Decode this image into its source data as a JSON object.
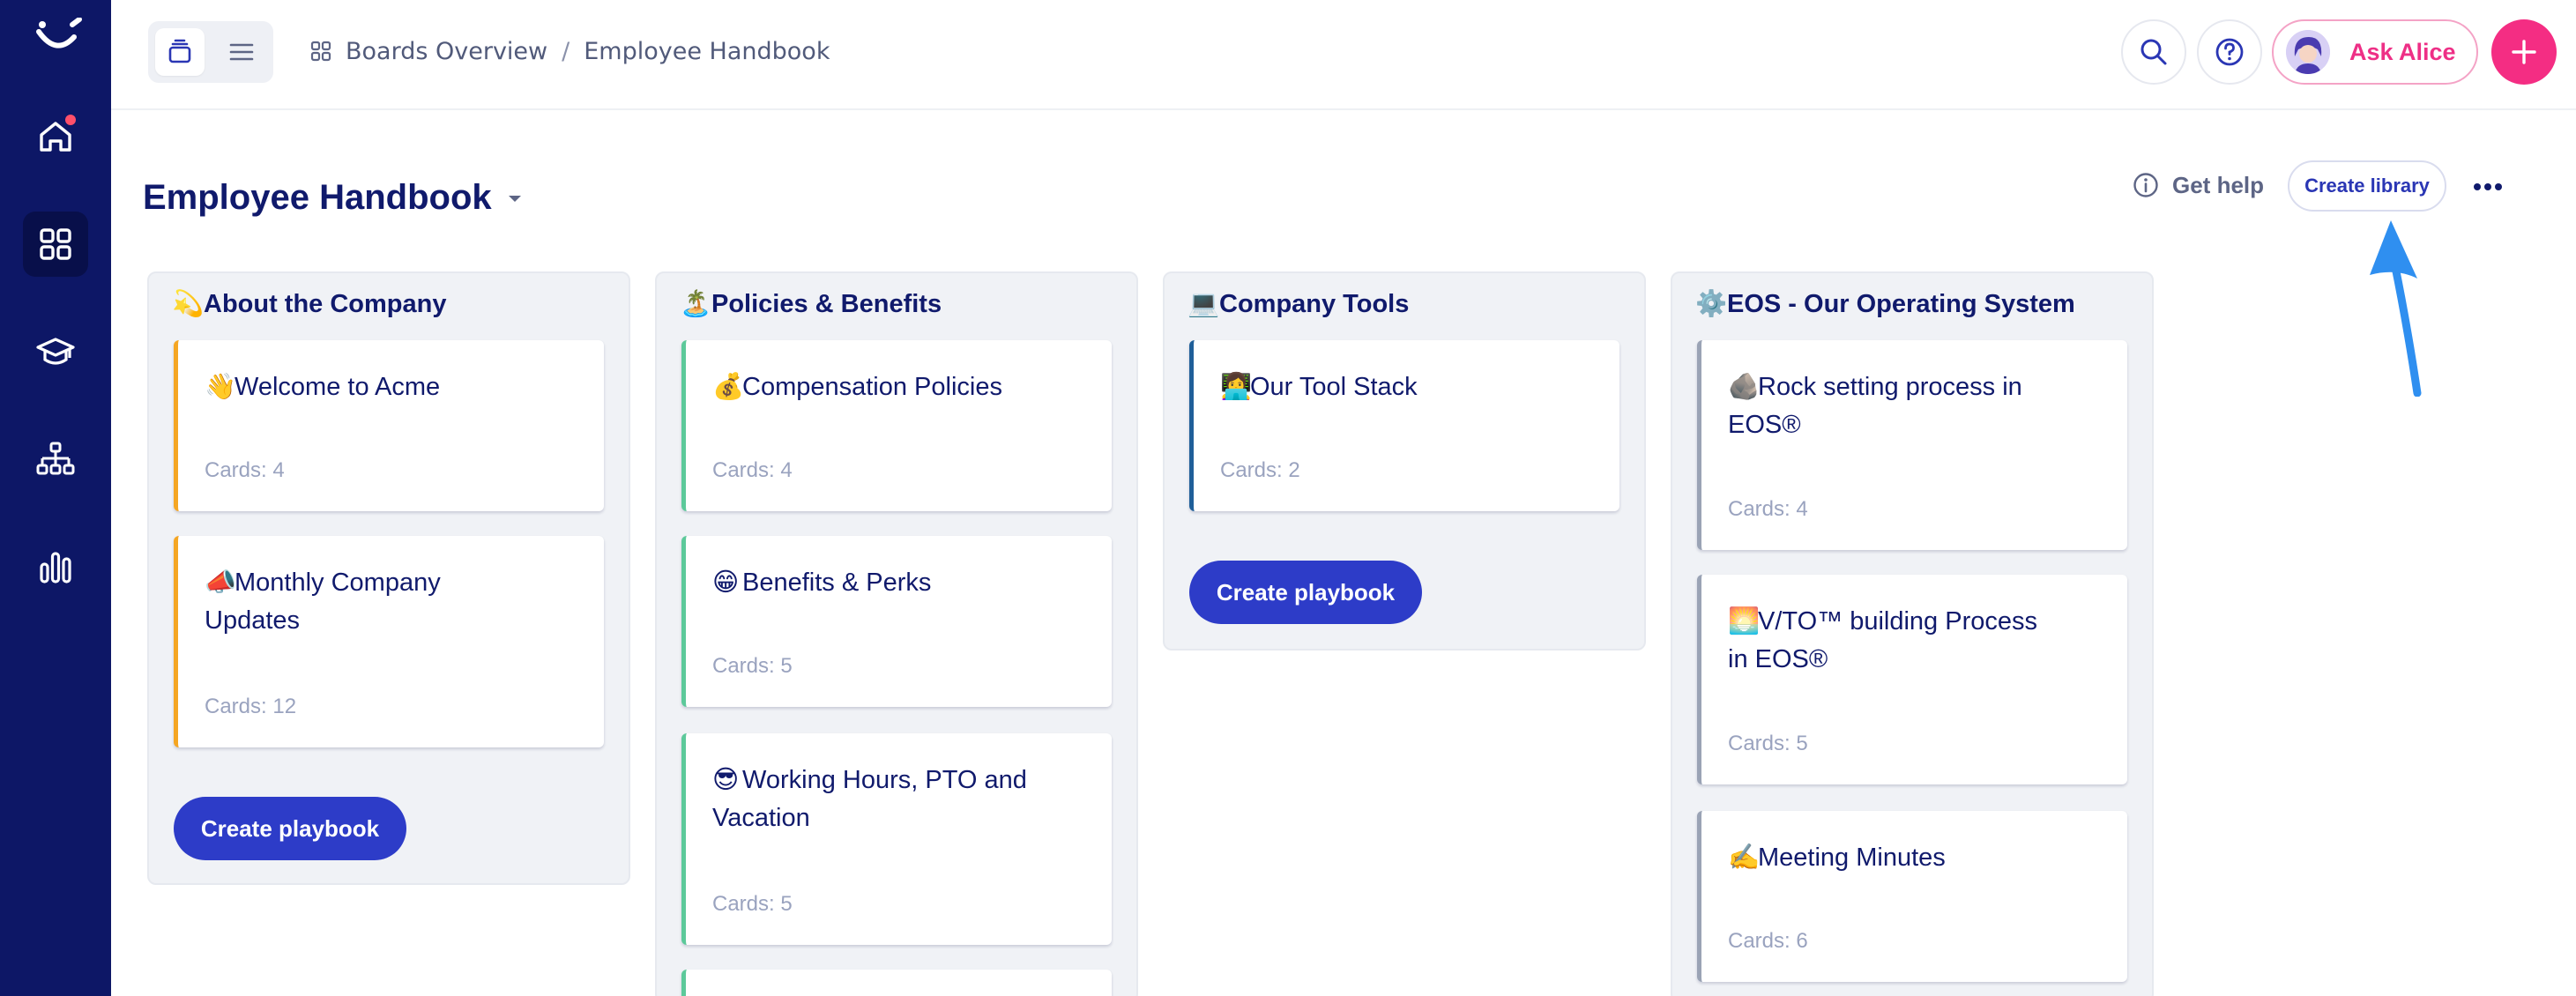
{
  "sidebar": {
    "items": [
      {
        "name": "home",
        "icon": "home-icon",
        "has_notification": true
      },
      {
        "name": "boards",
        "icon": "grid-icon",
        "active": true
      },
      {
        "name": "academy",
        "icon": "graduation-cap-icon"
      },
      {
        "name": "org-chart",
        "icon": "org-chart-icon"
      },
      {
        "name": "analytics",
        "icon": "bar-chart-icon"
      }
    ]
  },
  "topbar": {
    "breadcrumb": {
      "root": "Boards Overview",
      "separator": "/",
      "current": "Employee Handbook"
    },
    "ask_alice_label": "Ask Alice"
  },
  "page": {
    "title": "Employee Handbook",
    "get_help_label": "Get help",
    "create_library_label": "Create library"
  },
  "columns": [
    {
      "emoji": "💫",
      "title": "About the Company",
      "accent": "#f5a623",
      "cards": [
        {
          "emoji": "👋",
          "title": "Welcome to Acme",
          "count": "Cards: 4"
        },
        {
          "emoji": "📣",
          "title": "Monthly Company Updates",
          "count": "Cards: 12"
        }
      ],
      "button": "Create playbook"
    },
    {
      "emoji": "🏝️",
      "title": "Policies & Benefits",
      "accent": "#5cc99a",
      "cards": [
        {
          "emoji": "💰",
          "title": "Compensation Policies",
          "count": "Cards: 4"
        },
        {
          "emoji": "😁",
          "title": "Benefits & Perks",
          "count": "Cards: 5"
        },
        {
          "emoji": "😎",
          "title": "Working Hours, PTO and Vacation",
          "count": "Cards: 5"
        }
      ]
    },
    {
      "emoji": "💻",
      "title": "Company Tools",
      "accent": "#1f5f99",
      "cards": [
        {
          "emoji": "👩‍💻",
          "title": "Our Tool Stack",
          "count": "Cards: 2"
        }
      ],
      "button": "Create playbook"
    },
    {
      "emoji": "⚙️",
      "title": "EOS - Our Operating System",
      "accent": "#9aa3b5",
      "cards": [
        {
          "emoji": "🪨",
          "title": "Rock setting process in EOS®",
          "count": "Cards: 4"
        },
        {
          "emoji": "🌅",
          "title": "V/TO™ building Process in EOS®",
          "count": "Cards: 5"
        },
        {
          "emoji": "✍️",
          "title": "Meeting Minutes",
          "count": "Cards: 6"
        }
      ]
    }
  ],
  "colors": {
    "sidebar": "#0d1766",
    "primary_button": "#2d3cc8",
    "brand_pink": "#f42d83",
    "annotation_arrow": "#2f8ff0"
  }
}
